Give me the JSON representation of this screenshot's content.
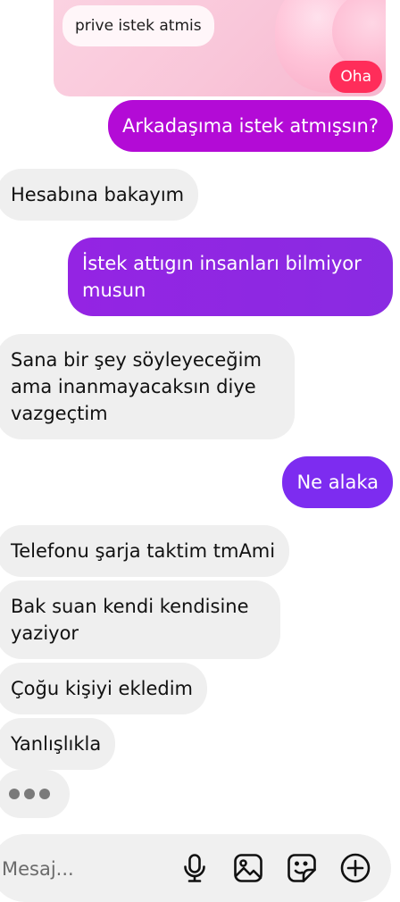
{
  "shared_post": {
    "caption": "prive istek atmis",
    "reaction": "Oha"
  },
  "messages": [
    {
      "id": "m1",
      "text": "Arkadaşıma istek atmışsın?"
    },
    {
      "id": "m2",
      "text": "Hesabına bakayım"
    },
    {
      "id": "m3",
      "text": "İstek attıgın insanları bilmiyor\nmusun"
    },
    {
      "id": "m4",
      "text": "Sana bir şey söyleyeceğim\nama inanmayacaksın diye\nvazgeçtim"
    },
    {
      "id": "m5",
      "text": "Ne alaka"
    },
    {
      "id": "m6",
      "text": "Telefonu şarja taktim tmAmi"
    },
    {
      "id": "m7",
      "text": "Bak suan kendi kendisine\nyaziyor"
    },
    {
      "id": "m8",
      "text": "Çoğu kişiyi ekledim"
    },
    {
      "id": "m9",
      "text": "Yanlışlıkla"
    }
  ],
  "composer": {
    "placeholder": "Mesaj...",
    "icons": [
      "microphone-icon",
      "image-icon",
      "sticker-icon",
      "plus-circle-icon"
    ]
  },
  "colors": {
    "incoming_bubble": "#efefef",
    "outgoing_magenta": "#b30bd6",
    "outgoing_purple": "#8a2be2",
    "outgoing_violet": "#7d2cf0",
    "reaction_pink": "#ff2d5a"
  }
}
